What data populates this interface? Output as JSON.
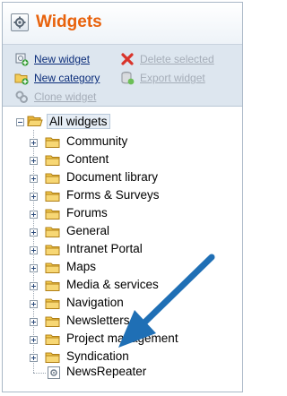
{
  "header": {
    "title": "Widgets",
    "icon": "widget-settings-icon"
  },
  "actions": {
    "new_widget": "New widget",
    "delete_selected": "Delete selected",
    "new_category": "New category",
    "export_widget": "Export widget",
    "clone_widget": "Clone widget"
  },
  "tree": {
    "root": "All widgets",
    "categories": [
      "Community",
      "Content",
      "Document library",
      "Forms & Surveys",
      "Forums",
      "General",
      "Intranet Portal",
      "Maps",
      "Media & services",
      "Navigation",
      "Newsletters",
      "Project management",
      "Syndication"
    ],
    "widget": "NewsRepeater"
  },
  "colors": {
    "title": "#e8620c",
    "link": "#0b2d7a",
    "disabled_link": "#a5adb8",
    "toolbar_bg": "#dde6ef",
    "arrow": "#1f6fb5"
  }
}
